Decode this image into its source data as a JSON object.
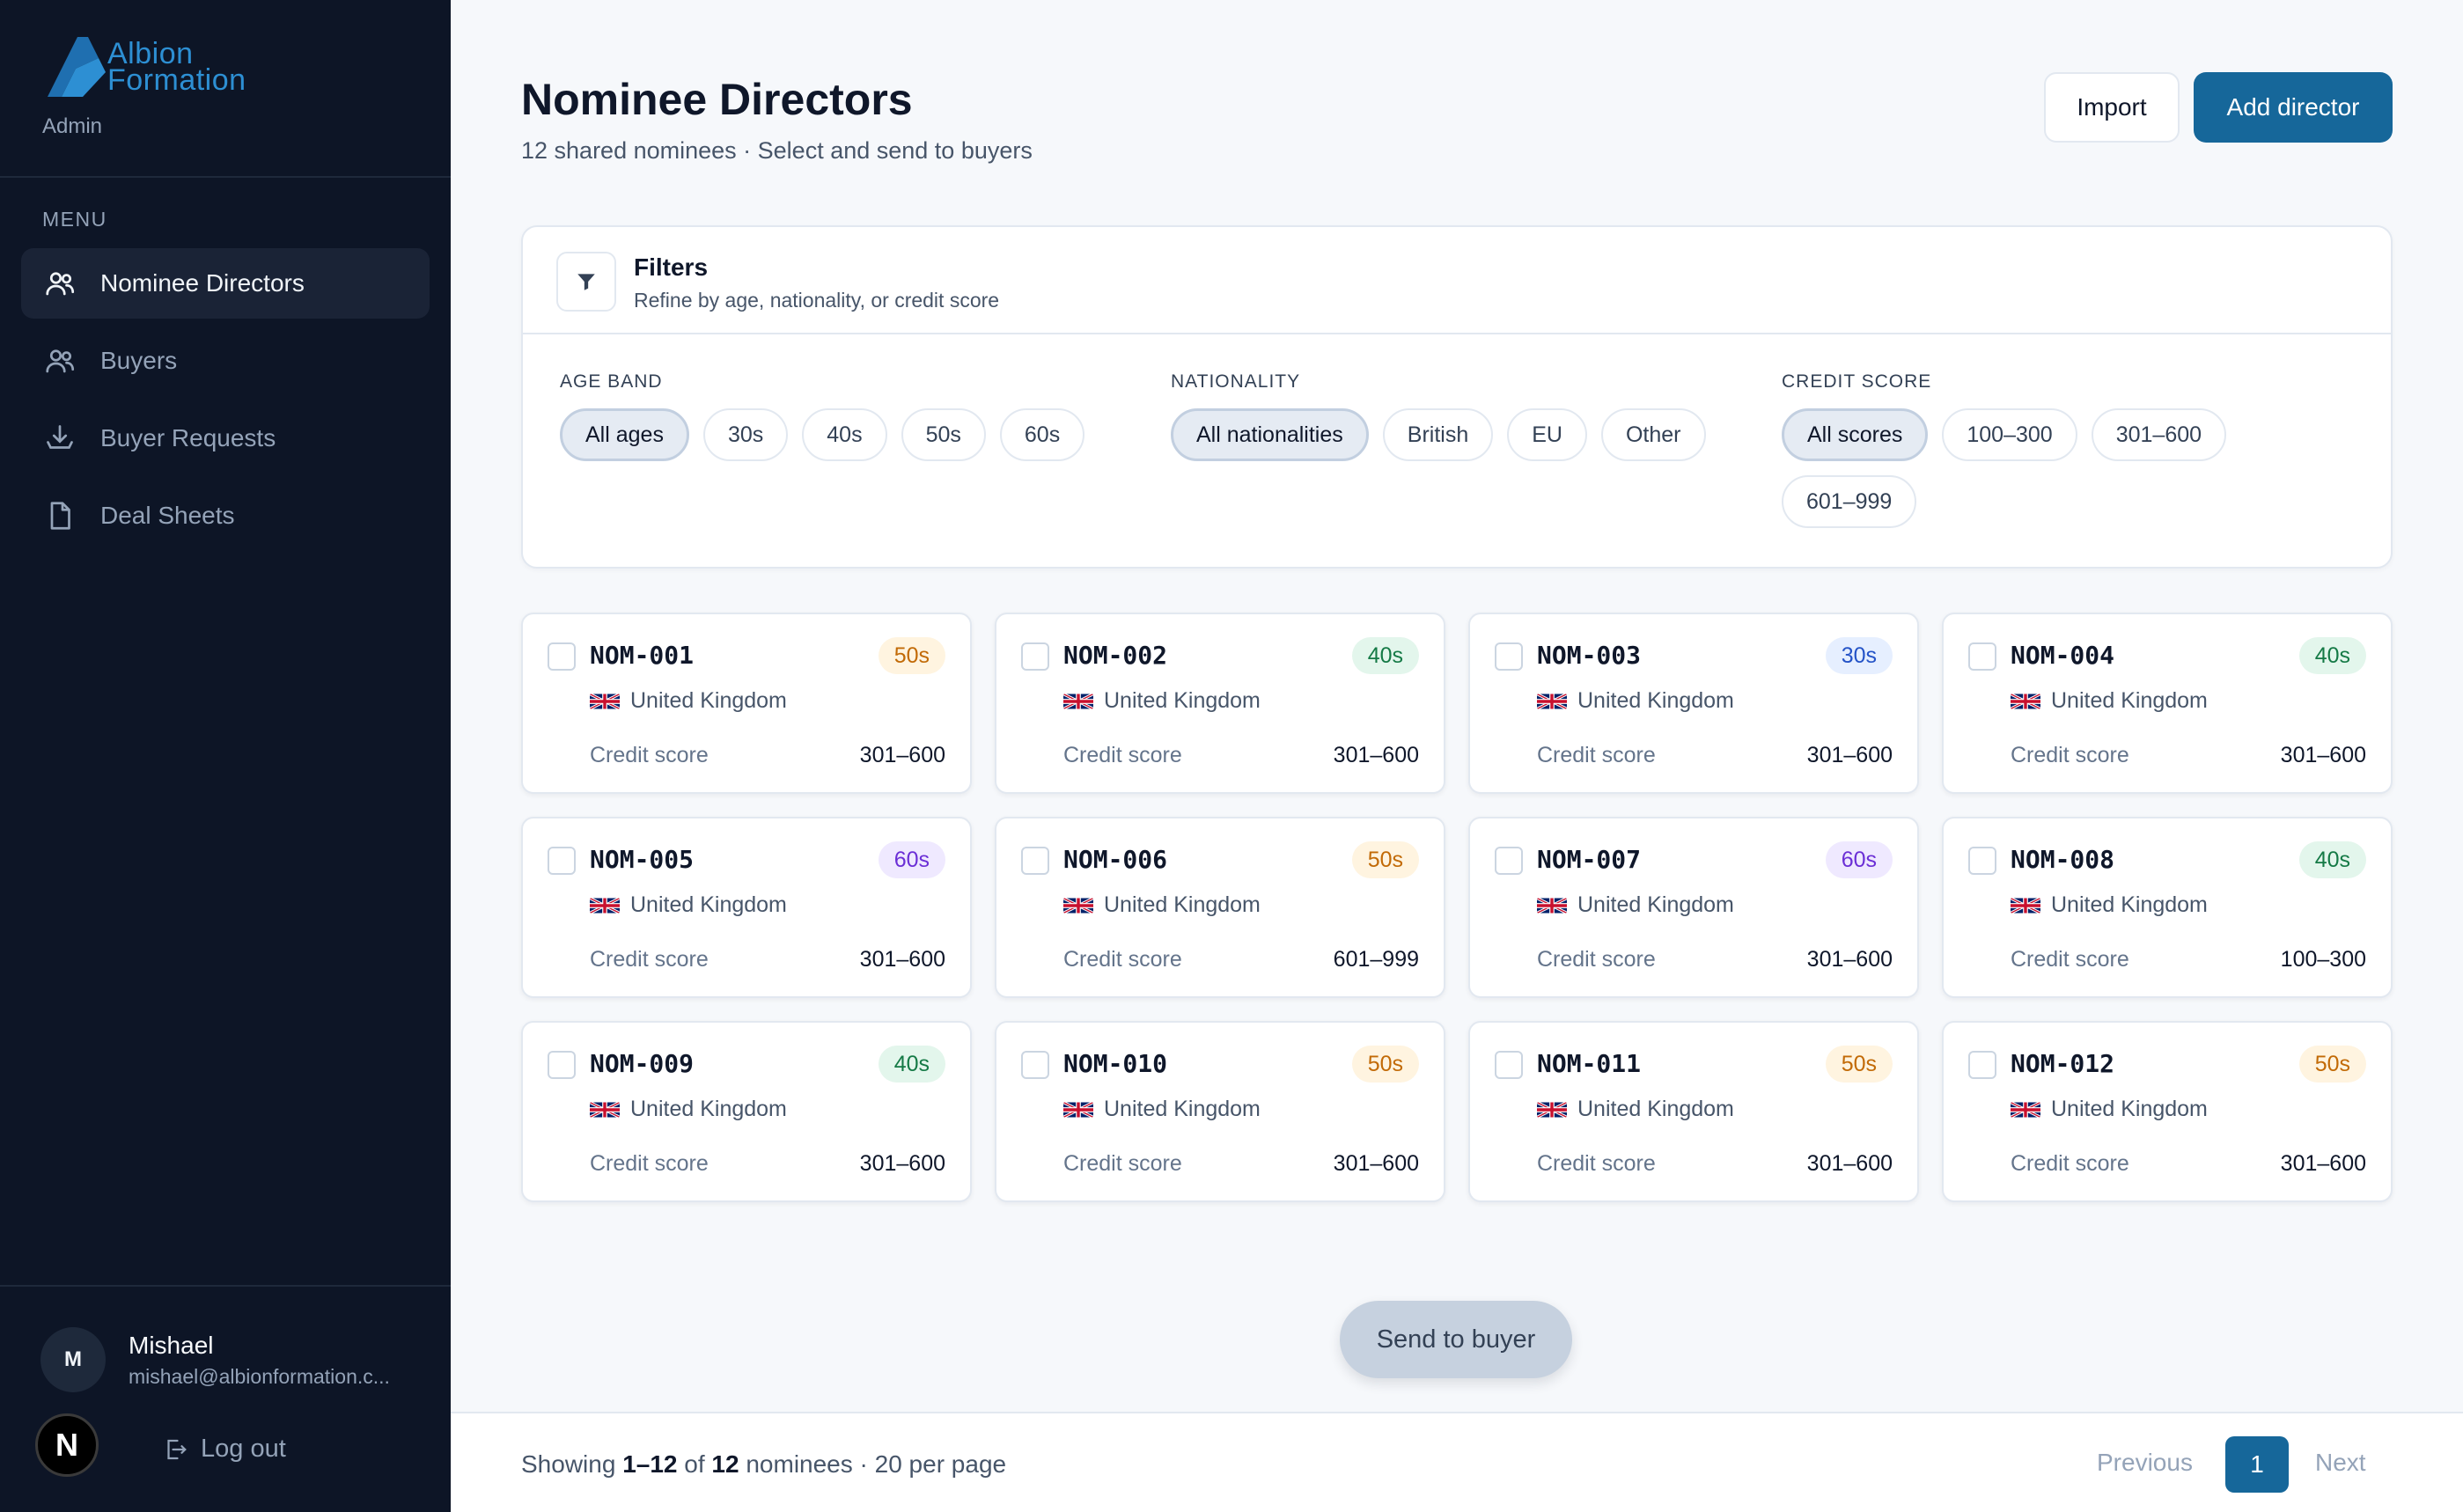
{
  "brand": {
    "line1": "Albion",
    "line2": "Formation",
    "role": "Admin"
  },
  "sidebar": {
    "menu_label": "MENU",
    "items": [
      {
        "label": "Nominee Directors",
        "icon": "users-icon",
        "active": true
      },
      {
        "label": "Buyers",
        "icon": "users-icon",
        "active": false
      },
      {
        "label": "Buyer Requests",
        "icon": "inbox-download-icon",
        "active": false
      },
      {
        "label": "Deal Sheets",
        "icon": "document-icon",
        "active": false
      }
    ],
    "user": {
      "initial": "M",
      "name": "Mishael",
      "email": "mishael@albionformation.c..."
    },
    "n_badge": "N",
    "logout_label": "Log out"
  },
  "header": {
    "title": "Nominee Directors",
    "subtitle": "12 shared nominees · Select and send to buyers",
    "import_label": "Import",
    "add_label": "Add director"
  },
  "filters": {
    "title": "Filters",
    "subtitle": "Refine by age, nationality, or credit score",
    "age": {
      "label": "AGE BAND",
      "options": [
        "All ages",
        "30s",
        "40s",
        "50s",
        "60s"
      ],
      "selected": "All ages"
    },
    "nationality": {
      "label": "NATIONALITY",
      "options": [
        "All nationalities",
        "British",
        "EU",
        "Other"
      ],
      "selected": "All nationalities"
    },
    "credit": {
      "label": "CREDIT SCORE",
      "options": [
        "All scores",
        "100–300",
        "301–600",
        "601–999"
      ],
      "selected": "All scores"
    }
  },
  "cards": {
    "credit_label": "Credit score",
    "items": [
      {
        "id": "NOM-001",
        "age": "50s",
        "country": "United Kingdom",
        "score": "301–600"
      },
      {
        "id": "NOM-002",
        "age": "40s",
        "country": "United Kingdom",
        "score": "301–600"
      },
      {
        "id": "NOM-003",
        "age": "30s",
        "country": "United Kingdom",
        "score": "301–600"
      },
      {
        "id": "NOM-004",
        "age": "40s",
        "country": "United Kingdom",
        "score": "301–600"
      },
      {
        "id": "NOM-005",
        "age": "60s",
        "country": "United Kingdom",
        "score": "301–600"
      },
      {
        "id": "NOM-006",
        "age": "50s",
        "country": "United Kingdom",
        "score": "601–999"
      },
      {
        "id": "NOM-007",
        "age": "60s",
        "country": "United Kingdom",
        "score": "301–600"
      },
      {
        "id": "NOM-008",
        "age": "40s",
        "country": "United Kingdom",
        "score": "100–300"
      },
      {
        "id": "NOM-009",
        "age": "40s",
        "country": "United Kingdom",
        "score": "301–600"
      },
      {
        "id": "NOM-010",
        "age": "50s",
        "country": "United Kingdom",
        "score": "301–600"
      },
      {
        "id": "NOM-011",
        "age": "50s",
        "country": "United Kingdom",
        "score": "301–600"
      },
      {
        "id": "NOM-012",
        "age": "50s",
        "country": "United Kingdom",
        "score": "301–600"
      }
    ]
  },
  "send_label": "Send to buyer",
  "footer": {
    "showing": "Showing",
    "range": "1–12",
    "of": "of",
    "total": "12",
    "rest": "nominees · 20 per page",
    "prev": "Previous",
    "page": "1",
    "next": "Next"
  },
  "colors": {
    "accent": "#16679a",
    "sidebar_bg": "#0d1526",
    "brand_blue": "#2d8fd3"
  }
}
